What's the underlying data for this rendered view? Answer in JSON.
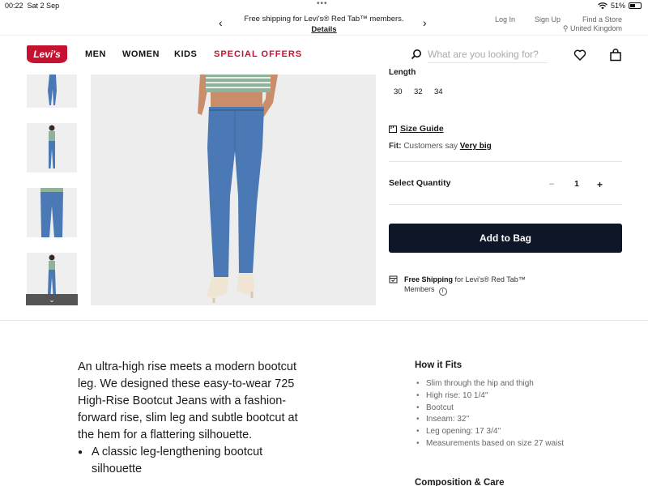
{
  "status_bar": {
    "time": "00:22",
    "date": "Sat 2 Sep",
    "battery": "51%",
    "battery_level": 0.51,
    "wifi_icon": "wifi-icon"
  },
  "promo": {
    "message": "Free shipping for Levi's® Red Tab™ members.",
    "link": "Details"
  },
  "utility_links": {
    "login": "Log In",
    "signup": "Sign Up",
    "find_store": "Find a Store",
    "region": "United Kingdom"
  },
  "header": {
    "logo": "Levi's",
    "nav": [
      "MEN",
      "WOMEN",
      "KIDS",
      "SPECIAL OFFERS"
    ],
    "search_placeholder": "What are you looking for?"
  },
  "product": {
    "length_label": "Length",
    "length_options": [
      "30",
      "32",
      "34"
    ],
    "size_guide": "Size Guide",
    "fit_label": "Fit:",
    "fit_text": "Customers say",
    "fit_value": "Very big",
    "quantity_label": "Select Quantity",
    "quantity_minus": "–",
    "quantity_value": "1",
    "quantity_plus": "+",
    "add_to_bag": "Add to Bag",
    "shipping_bold": "Free Shipping",
    "shipping_rest": "for Levi's® Red Tab™",
    "shipping_members": "Members"
  },
  "description": {
    "text": "An ultra-high rise meets a modern bootcut leg. We designed these easy-to-wear 725 High-Rise Bootcut Jeans with a fashion-forward rise, slim leg and subtle bootcut at the hem for a flattering silhouette.",
    "bullets": [
      "A classic leg-lengthening bootcut silhouette"
    ]
  },
  "how_it_fits": {
    "title": "How it Fits",
    "items": [
      "Slim through the hip and thigh",
      "High rise: 10 1/4''",
      "Bootcut",
      "Inseam: 32''",
      "Leg opening: 17 3/4''",
      "Measurements based on size 27 waist"
    ]
  },
  "composition": {
    "title": "Composition & Care"
  },
  "colors": {
    "brand_red": "#c41230",
    "button_navy": "#0f1628",
    "denim": "#4a79b5",
    "sweater_green": "#8fb39a"
  }
}
